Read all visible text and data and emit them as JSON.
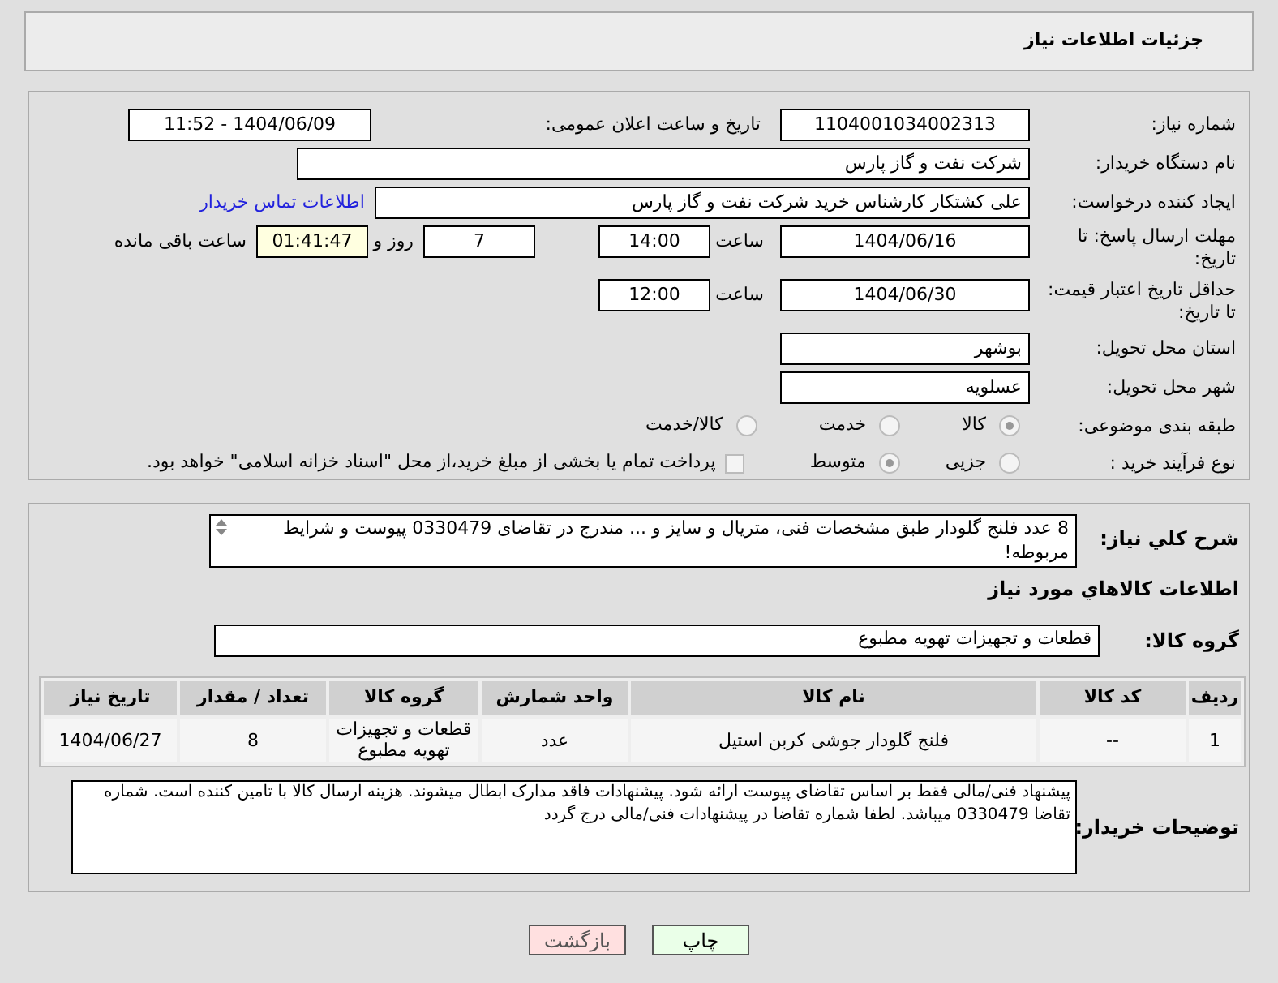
{
  "header": {
    "title": "جزئیات اطلاعات نیاز"
  },
  "need_number": {
    "label": "شماره نیاز:",
    "value": "1104001034002313"
  },
  "announce": {
    "label": "تاریخ و ساعت اعلان عمومی:",
    "value": "1404/06/09 - 11:52"
  },
  "buyer_org": {
    "label": "نام دستگاه خریدار:",
    "value": "شرکت نفت و گاز پارس"
  },
  "creator": {
    "label": "ایجاد کننده درخواست:",
    "value": "علی کشتکار کارشناس خرید شرکت نفت و گاز پارس",
    "link": "اطلاعات تماس خریدار"
  },
  "deadline": {
    "label": "مهلت ارسال پاسخ: تا تاریخ:",
    "date": "1404/06/16",
    "time_label": "ساعت",
    "time": "14:00",
    "days": "7",
    "days_label": "روز و",
    "remaining": "01:41:47",
    "remaining_label": "ساعت باقی مانده"
  },
  "validity": {
    "label": "حداقل تاریخ اعتبار قیمت: تا تاریخ:",
    "date": "1404/06/30",
    "time_label": "ساعت",
    "time": "12:00"
  },
  "province": {
    "label": "استان محل تحویل:",
    "value": "بوشهر"
  },
  "city": {
    "label": "شهر محل تحویل:",
    "value": "عسلویه"
  },
  "category": {
    "label": "طبقه بندی موضوعی:",
    "options": [
      {
        "label": "کالا",
        "selected": true
      },
      {
        "label": "خدمت",
        "selected": false
      },
      {
        "label": "کالا/خدمت",
        "selected": false
      }
    ]
  },
  "process": {
    "label": "نوع فرآیند خرید :",
    "options": [
      {
        "label": "جزیی",
        "selected": false
      },
      {
        "label": "متوسط",
        "selected": true
      }
    ],
    "treasury": {
      "checked": false,
      "label": "پرداخت تمام یا بخشی از مبلغ خرید،از محل \"اسناد خزانه اسلامی\" خواهد بود."
    }
  },
  "summary": {
    "label": "شرح کلي نياز:",
    "value": "8 عدد فلنج گلودار طبق مشخصات فنی، متریال و سایز و ... مندرج در تقاضای 0330479 پیوست و شرایط مربوطه!"
  },
  "goods_heading": "اطلاعات كالاهاي مورد نياز",
  "goods_group": {
    "label": "گروه کالا:",
    "value": "قطعات و تجهیزات تهویه مطبوع"
  },
  "table": {
    "columns": [
      "ردیف",
      "کد کالا",
      "نام کالا",
      "واحد شمارش",
      "گروه کالا",
      "تعداد / مقدار",
      "تاریخ نیاز"
    ],
    "rows": [
      [
        "1",
        "--",
        "فلنج گلودار جوشی کربن استیل",
        "عدد",
        "قطعات و تجهیزات تهویه مطبوع",
        "8",
        "1404/06/27"
      ]
    ]
  },
  "notes": {
    "label": "توضیحات خریدار:",
    "value": "پیشنهاد فنی/مالی فقط بر اساس تقاضای پیوست ارائه شود. پیشنهادات فاقد مدارک ابطال میشوند. هزینه ارسال کالا با تامین کننده است. شماره تقاضا 0330479 میباشد. لطفا شماره تقاضا در پیشنهادات فنی/مالی درج گردد"
  },
  "buttons": [
    {
      "label": "چاپ",
      "kind": "print"
    },
    {
      "label": "بازگشت",
      "kind": "back"
    }
  ]
}
